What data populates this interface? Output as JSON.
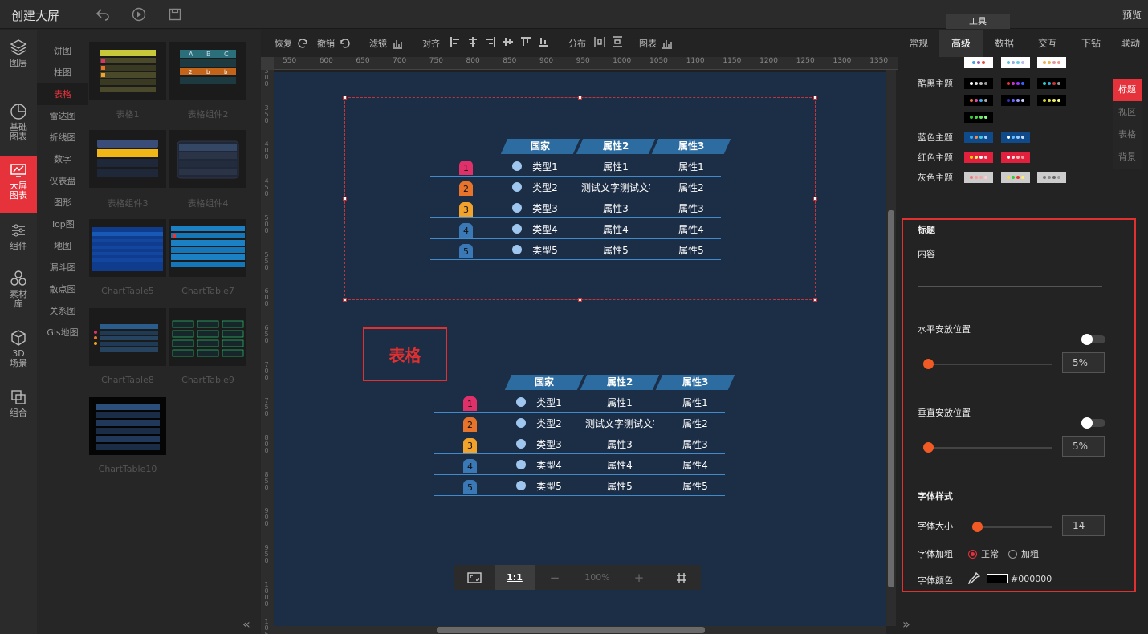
{
  "app": {
    "title": "创建大屏",
    "preview": "预览",
    "tools_tab": "工具"
  },
  "leftnav": [
    {
      "label": "图层",
      "icon": "layers-icon"
    },
    {
      "label": "基础图表",
      "icon": "pie-chart-icon"
    },
    {
      "label": "大屏图表",
      "icon": "screen-chart-icon"
    },
    {
      "label": "组件",
      "icon": "sliders-icon"
    },
    {
      "label": "素材库",
      "icon": "material-icon"
    },
    {
      "label": "3D场景",
      "icon": "cube-icon"
    },
    {
      "label": "组合",
      "icon": "combine-icon"
    }
  ],
  "subnav": [
    "饼图",
    "柱图",
    "表格",
    "雷达图",
    "折线图",
    "数字",
    "仪表盘",
    "图形",
    "Top图",
    "地图",
    "漏斗图",
    "散点图",
    "关系图",
    "Gis地图"
  ],
  "thumbnails": [
    "表格1",
    "表格组件2",
    "表格组件3",
    "表格组件4",
    "ChartTable5",
    "ChartTable7",
    "ChartTable8",
    "ChartTable9",
    "ChartTable10"
  ],
  "toolbar": {
    "redo": "恢复",
    "undo": "撤销",
    "filter": "滤镜",
    "align": "对齐",
    "distribute": "分布",
    "chart": "图表"
  },
  "ruler": [
    "550",
    "600",
    "650",
    "700",
    "750",
    "800",
    "850",
    "900",
    "950",
    "1000",
    "1050",
    "1100",
    "1150",
    "1200",
    "1250",
    "1300",
    "1350"
  ],
  "vruler": [
    "300",
    "350",
    "400",
    "450",
    "500",
    "550",
    "600",
    "650",
    "700",
    "750",
    "800",
    "850",
    "900",
    "950",
    "1000",
    "1050"
  ],
  "table": {
    "headers": [
      "国家",
      "属性2",
      "属性3"
    ],
    "rows": [
      {
        "rank": "1",
        "type": "类型1",
        "p2": "属性1",
        "p3": "属性1"
      },
      {
        "rank": "2",
        "type": "类型2",
        "p2": "测试文字测试文字",
        "p3": "属性2"
      },
      {
        "rank": "3",
        "type": "类型3",
        "p2": "属性3",
        "p3": "属性3"
      },
      {
        "rank": "4",
        "type": "类型4",
        "p2": "属性4",
        "p3": "属性4"
      },
      {
        "rank": "5",
        "type": "类型5",
        "p2": "属性5",
        "p3": "属性5"
      }
    ],
    "rank_colors": [
      "#e0306a",
      "#e8732a",
      "#f1a32b",
      "#3a79b5",
      "#3a79b5"
    ]
  },
  "canvas_title": "表格",
  "zoom": {
    "fit_label": "1:1",
    "minus": "−",
    "value": "100%",
    "plus": "+"
  },
  "rtabs": [
    "常规",
    "高级",
    "数据",
    "交互",
    "下钻",
    "联动"
  ],
  "themes": {
    "dark": "酷黑主题",
    "blue": "蓝色主题",
    "red": "红色主题",
    "gray": "灰色主题"
  },
  "sidetabs": [
    "标题",
    "视区",
    "表格",
    "背景"
  ],
  "props": {
    "section_title": "标题",
    "content_label": "内容",
    "h_pos_label": "水平安放位置",
    "h_pos_value": "5%",
    "v_pos_label": "垂直安放位置",
    "v_pos_value": "5%",
    "font_style_label": "字体样式",
    "font_size_label": "字体大小",
    "font_size_value": "14",
    "font_bold_label": "字体加粗",
    "bold_normal": "正常",
    "bold_bold": "加粗",
    "font_color_label": "字体颜色",
    "font_color_value": "#000000"
  }
}
